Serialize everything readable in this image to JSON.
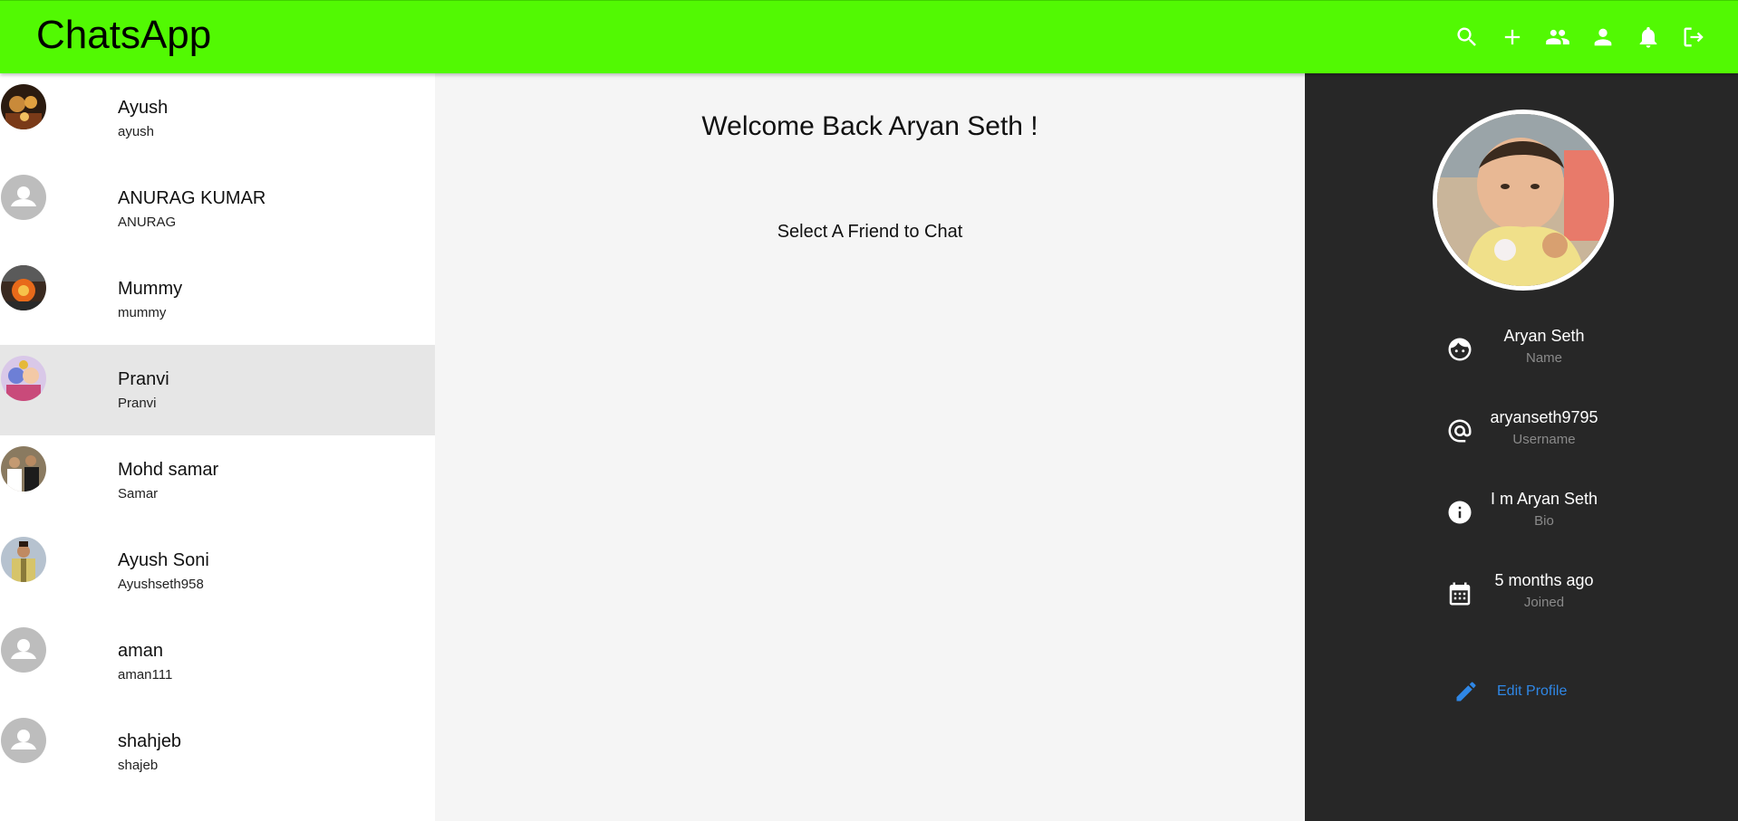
{
  "app": {
    "title": "ChatsApp"
  },
  "header": {
    "actions": [
      {
        "name": "search-icon"
      },
      {
        "name": "add-icon"
      },
      {
        "name": "group-icon"
      },
      {
        "name": "person-icon"
      },
      {
        "name": "bell-icon"
      },
      {
        "name": "logout-icon"
      }
    ]
  },
  "friends": [
    {
      "name": "Ayush",
      "username": "ayush",
      "avatar": "photo",
      "selected": false
    },
    {
      "name": "ANURAG KUMAR",
      "username": "ANURAG",
      "avatar": "placeholder",
      "selected": false
    },
    {
      "name": "Mummy",
      "username": "mummy",
      "avatar": "photo",
      "selected": false
    },
    {
      "name": "Pranvi",
      "username": "Pranvi",
      "avatar": "photo",
      "selected": true
    },
    {
      "name": "Mohd samar",
      "username": "Samar",
      "avatar": "photo",
      "selected": false
    },
    {
      "name": "Ayush Soni",
      "username": "Ayushseth958",
      "avatar": "photo",
      "selected": false
    },
    {
      "name": "aman",
      "username": "aman111",
      "avatar": "placeholder",
      "selected": false
    },
    {
      "name": "shahjeb",
      "username": "shajeb",
      "avatar": "placeholder",
      "selected": false
    }
  ],
  "center": {
    "welcome": "Welcome Back Aryan Seth !",
    "hint": "Select A Friend to Chat"
  },
  "profile": {
    "name_value": "Aryan Seth",
    "name_label": "Name",
    "username_value": "aryanseth9795",
    "username_label": "Username",
    "bio_value": "I m Aryan Seth",
    "bio_label": "Bio",
    "joined_value": "5 months ago",
    "joined_label": "Joined",
    "edit_label": "Edit Profile"
  },
  "colors": {
    "header": "#52f903",
    "panel": "#272727",
    "accent": "#2f87e6"
  }
}
